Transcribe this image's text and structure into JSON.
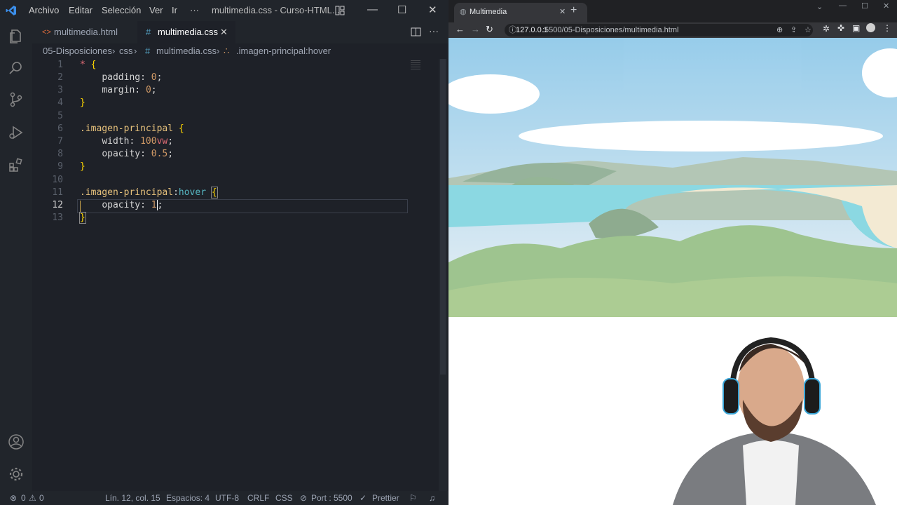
{
  "vscode": {
    "menu": [
      "Archivo",
      "Editar",
      "Selección",
      "Ver",
      "Ir",
      "···"
    ],
    "title": "multimedia.css - Curso-HTML...",
    "tabs": [
      {
        "label": "multimedia.html",
        "icon": "<>"
      },
      {
        "label": "multimedia.css",
        "icon": "#"
      }
    ],
    "breadcrumb": [
      "05-Disposiciones",
      "css",
      "multimedia.css",
      ".imagen-principal:hover"
    ],
    "line_numbers": [
      "1",
      "2",
      "3",
      "4",
      "5",
      "6",
      "7",
      "8",
      "9",
      "10",
      "11",
      "12",
      "13"
    ],
    "status": {
      "errors": "0",
      "warnings": "0",
      "position": "Lín. 12, col. 15",
      "spaces": "Espacios: 4",
      "encoding": "UTF-8",
      "eol": "CRLF",
      "language": "CSS",
      "port": "Port : 5500",
      "prettier": "Prettier"
    }
  },
  "browser": {
    "tab_title": "Multimedia",
    "url_host": "127.0.0.1",
    "url_path": ":5500/05-Disposiciones/multimedia.html"
  },
  "colors": {
    "editor_bg": "#1e2128",
    "accent": "#3b8eea"
  }
}
